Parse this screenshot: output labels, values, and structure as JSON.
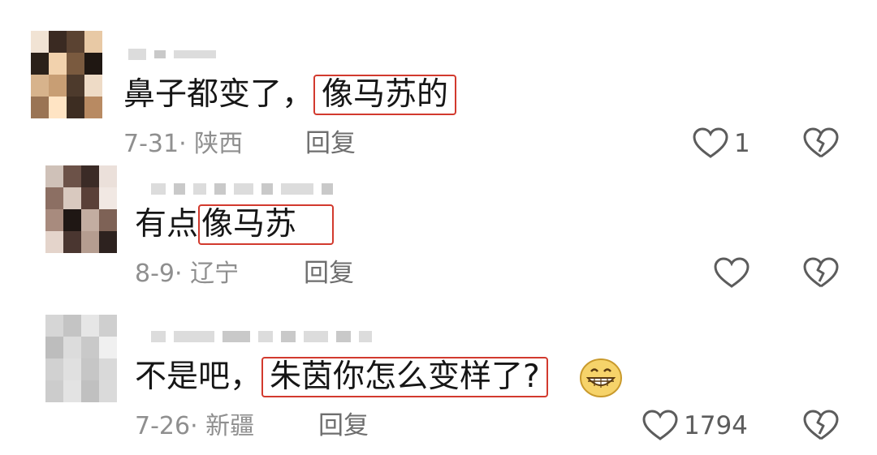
{
  "comments": [
    {
      "text_prefix": "鼻子都变了，",
      "highlight": "像马苏的",
      "text_suffix": "",
      "date_region": "7-31· 陕西",
      "reply_label": "回复",
      "like_count": "1",
      "avatar_palette": [
        "#f1e3d4",
        "#3a2a22",
        "#5b4332",
        "#e8c9a5",
        "#2b2119",
        "#f2d2ad",
        "#7a5a3f",
        "#1f1712",
        "#d7b38c",
        "#c89e74",
        "#4d3a2c",
        "#eedbc6",
        "#9a7454",
        "#ffe4c4",
        "#3d2d22",
        "#b88a62"
      ]
    },
    {
      "text_prefix": "有点",
      "highlight": "像马苏",
      "text_suffix": "",
      "date_region": "8-9· 辽宁",
      "reply_label": "回复",
      "like_count": "",
      "avatar_palette": [
        "#cfc1b8",
        "#6c5248",
        "#3b2b26",
        "#ebe0da",
        "#8c6f63",
        "#d9c9bf",
        "#5a4038",
        "#f1e8e3",
        "#a88b7e",
        "#1f1714",
        "#c3ada1",
        "#7e6256",
        "#e4d4cb",
        "#4a3630",
        "#b59d90",
        "#2d221f"
      ]
    },
    {
      "text_prefix": "不是吧，",
      "highlight": "朱茵你怎么变样了?",
      "text_suffix": "",
      "date_region": "7-26· 新疆",
      "reply_label": "回复",
      "like_count": "1794",
      "avatar_palette": [
        "#d6d6d6",
        "#c4c4c4",
        "#e6e6e6",
        "#cfcfcf",
        "#bdbdbd",
        "#dcdcdc",
        "#c9c9c9",
        "#f0f0f0",
        "#d1d1d1",
        "#e0e0e0",
        "#c6c6c6",
        "#d9d9d9",
        "#cccccc",
        "#e3e3e3",
        "#c0c0c0",
        "#dadada"
      ]
    }
  ],
  "colors": {
    "highlight_border": "#d23a2e",
    "meta_text": "#8f8f8f",
    "icon_stroke": "#5c5c5c"
  },
  "icons": [
    "heart-icon",
    "broken-heart-icon",
    "grinning-emoji-icon"
  ]
}
